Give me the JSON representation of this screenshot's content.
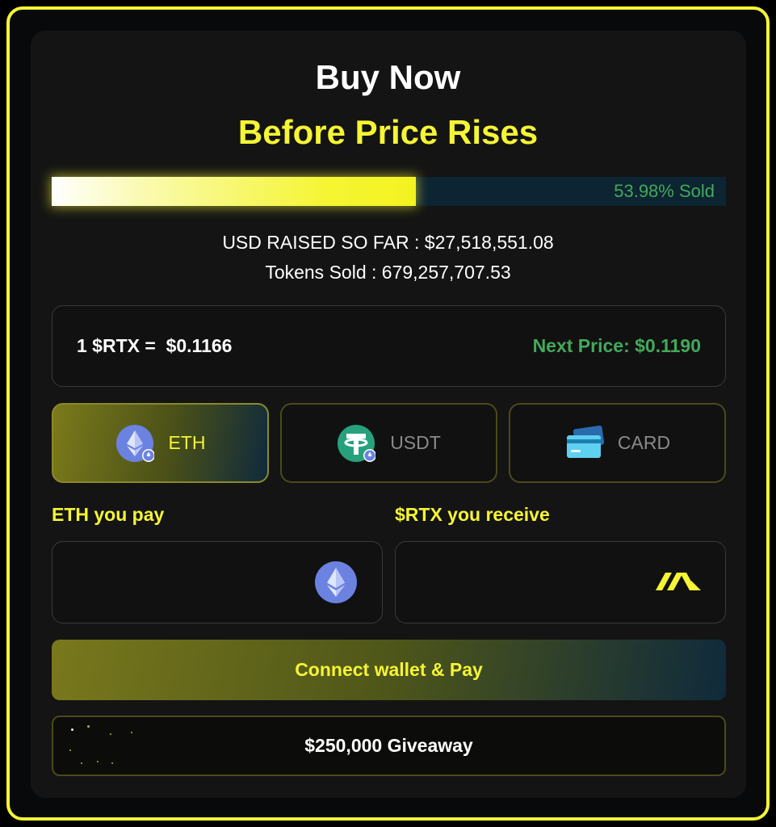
{
  "header": {
    "title": "Buy Now",
    "subtitle": "Before Price Rises"
  },
  "progress": {
    "sold_percent": 53.98,
    "label": "53.98% Sold"
  },
  "stats": {
    "usd_raised": "USD RAISED SO FAR : $27,518,551.08",
    "tokens_sold": "Tokens Sold : 679,257,707.53"
  },
  "price": {
    "current": "1 $RTX =  $0.1166",
    "next": "Next Price: $0.1190"
  },
  "payment_tabs": [
    {
      "label": "ETH",
      "icon": "eth-icon",
      "active": true
    },
    {
      "label": "USDT",
      "icon": "usdt-icon",
      "active": false
    },
    {
      "label": "CARD",
      "icon": "credit-card-icon",
      "active": false
    }
  ],
  "form": {
    "pay_label": "ETH you pay",
    "pay_value": "",
    "receive_label": "$RTX you receive",
    "receive_value": ""
  },
  "actions": {
    "connect_label": "Connect wallet & Pay",
    "giveaway_label": "$250,000 Giveaway"
  },
  "colors": {
    "accent": "#f5f534",
    "green": "#43a95a",
    "progress_bg": "#0d2432"
  }
}
